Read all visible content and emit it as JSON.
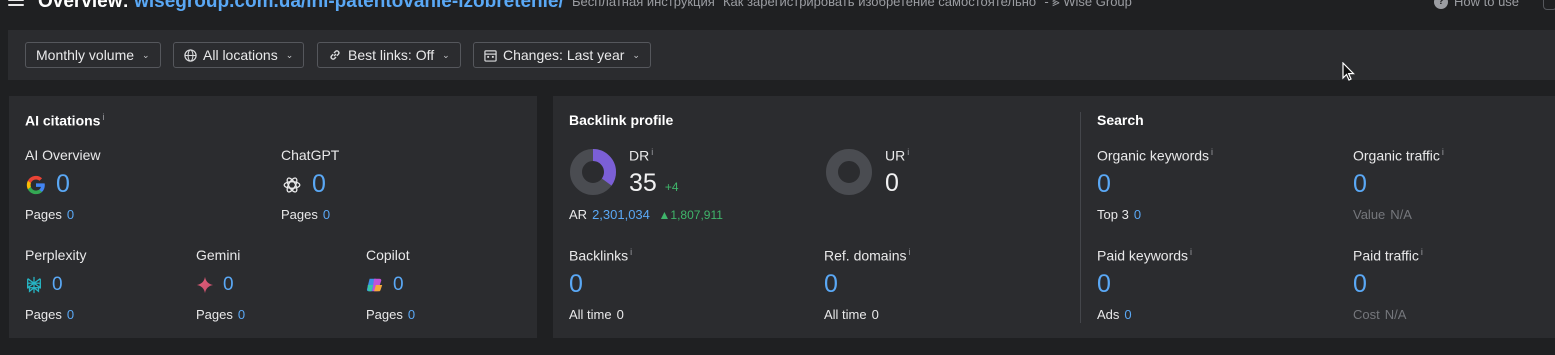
{
  "header": {
    "title_prefix": "Overview:",
    "title_url": "wisegroup.com.ua/ini-patentovanie-izobretenie/",
    "page_title": "Бесплатная инструкция \"Как зарегистрировать изобретение самостоятельно\" - ⪢ Wise Group",
    "help_label": "How to use"
  },
  "filters": {
    "volume": "Monthly volume",
    "locations": "All locations",
    "best_links": "Best links: Off",
    "changes": "Changes: Last year"
  },
  "ai_citations": {
    "title": "AI citations",
    "info": "i",
    "ai_overview": {
      "label": "AI Overview",
      "value": "0",
      "pages_label": "Pages",
      "pages": "0"
    },
    "chatgpt": {
      "label": "ChatGPT",
      "value": "0",
      "pages_label": "Pages",
      "pages": "0"
    },
    "perplexity": {
      "label": "Perplexity",
      "value": "0",
      "pages_label": "Pages",
      "pages": "0"
    },
    "gemini": {
      "label": "Gemini",
      "value": "0",
      "pages_label": "Pages",
      "pages": "0"
    },
    "copilot": {
      "label": "Copilot",
      "value": "0",
      "pages_label": "Pages",
      "pages": "0"
    }
  },
  "backlink_profile": {
    "title": "Backlink profile",
    "dr": {
      "label": "DR",
      "info": "i",
      "value": "35",
      "delta": "+4",
      "fill_fraction": 0.35
    },
    "ar": {
      "label": "AR",
      "value": "2,301,034",
      "delta": "▲1,807,911"
    },
    "ur": {
      "label": "UR",
      "info": "i",
      "value": "0",
      "fill_fraction": 0
    },
    "backlinks": {
      "label": "Backlinks",
      "info": "i",
      "value": "0",
      "sub_label": "All time",
      "sub_value": "0"
    },
    "ref_domains": {
      "label": "Ref. domains",
      "info": "i",
      "value": "0",
      "sub_label": "All time",
      "sub_value": "0"
    }
  },
  "search": {
    "title": "Search",
    "organic_keywords": {
      "label": "Organic keywords",
      "info": "i",
      "value": "0",
      "sub_label": "Top 3",
      "sub_value": "0"
    },
    "organic_traffic": {
      "label": "Organic traffic",
      "info": "i",
      "value": "0",
      "sub_label": "Value",
      "sub_value": "N/A"
    },
    "paid_keywords": {
      "label": "Paid keywords",
      "info": "i",
      "value": "0",
      "sub_label": "Ads",
      "sub_value": "0"
    },
    "paid_traffic": {
      "label": "Paid traffic",
      "info": "i",
      "value": "0",
      "sub_label": "Cost",
      "sub_value": "N/A"
    }
  },
  "colors": {
    "accent": "#5aa8f5",
    "positive": "#3fb56a",
    "dr_fill": "#7b5fd6",
    "ring_track": "#4a4c51",
    "panel": "#2b2c2f",
    "background": "#1f2022"
  }
}
